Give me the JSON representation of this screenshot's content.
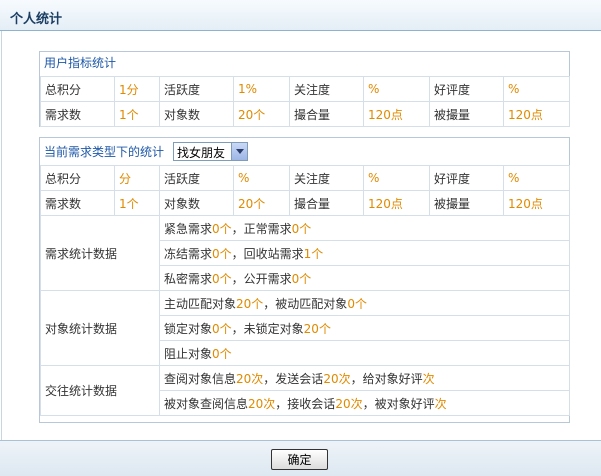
{
  "page": {
    "title": "个人统计"
  },
  "box1": {
    "caption": "用户指标统计",
    "rows": [
      [
        {
          "l": "总积分",
          "v": "1分"
        },
        {
          "l": "活跃度",
          "v": "1%"
        },
        {
          "l": "关注度",
          "v": "%"
        },
        {
          "l": "好评度",
          "v": "%"
        }
      ],
      [
        {
          "l": "需求数",
          "v": "1个"
        },
        {
          "l": "对象数",
          "v": "20个"
        },
        {
          "l": "撮合量",
          "v": "120点"
        },
        {
          "l": "被撮量",
          "v": "120点"
        }
      ]
    ]
  },
  "box2": {
    "caption": "当前需求类型下的统计",
    "select_value": "找女朋友",
    "rows": [
      [
        {
          "l": "总积分",
          "v": "分"
        },
        {
          "l": "活跃度",
          "v": "%"
        },
        {
          "l": "关注度",
          "v": "%"
        },
        {
          "l": "好评度",
          "v": "%"
        }
      ],
      [
        {
          "l": "需求数",
          "v": "1个"
        },
        {
          "l": "对象数",
          "v": "20个"
        },
        {
          "l": "撮合量",
          "v": "120点"
        },
        {
          "l": "被撮量",
          "v": "120点"
        }
      ]
    ],
    "sections": [
      {
        "label": "需求统计数据",
        "lines": [
          [
            {
              "t": "紧急需求"
            },
            {
              "t": "0个",
              "hl": true
            },
            {
              "t": "，正常需求"
            },
            {
              "t": "0个",
              "hl": true
            }
          ],
          [
            {
              "t": "冻结需求"
            },
            {
              "t": "0个",
              "hl": true
            },
            {
              "t": "，回收站需求"
            },
            {
              "t": "1个",
              "hl": true
            }
          ],
          [
            {
              "t": "私密需求"
            },
            {
              "t": "0个",
              "hl": true
            },
            {
              "t": "，公开需求"
            },
            {
              "t": "0个",
              "hl": true
            }
          ]
        ]
      },
      {
        "label": "对象统计数据",
        "lines": [
          [
            {
              "t": "主动匹配对象"
            },
            {
              "t": "20个",
              "hl": true
            },
            {
              "t": "，被动匹配对象"
            },
            {
              "t": "0个",
              "hl": true
            }
          ],
          [
            {
              "t": "锁定对象"
            },
            {
              "t": "0个",
              "hl": true
            },
            {
              "t": "，未锁定对象"
            },
            {
              "t": "20个",
              "hl": true
            }
          ],
          [
            {
              "t": "阻止对象"
            },
            {
              "t": "0个",
              "hl": true
            }
          ]
        ]
      },
      {
        "label": "交往统计数据",
        "lines": [
          [
            {
              "t": "查阅对象信息"
            },
            {
              "t": "20次",
              "hl": true
            },
            {
              "t": "，发送会话"
            },
            {
              "t": "20次",
              "hl": true
            },
            {
              "t": "，给对象好评"
            },
            {
              "t": "次",
              "hl": true
            }
          ],
          [
            {
              "t": "被对象查阅信息"
            },
            {
              "t": "20次",
              "hl": true
            },
            {
              "t": "，接收会话"
            },
            {
              "t": "20次",
              "hl": true
            },
            {
              "t": "，被对象好评"
            },
            {
              "t": "次",
              "hl": true
            }
          ]
        ]
      }
    ]
  },
  "footer": {
    "ok_label": "确定"
  }
}
